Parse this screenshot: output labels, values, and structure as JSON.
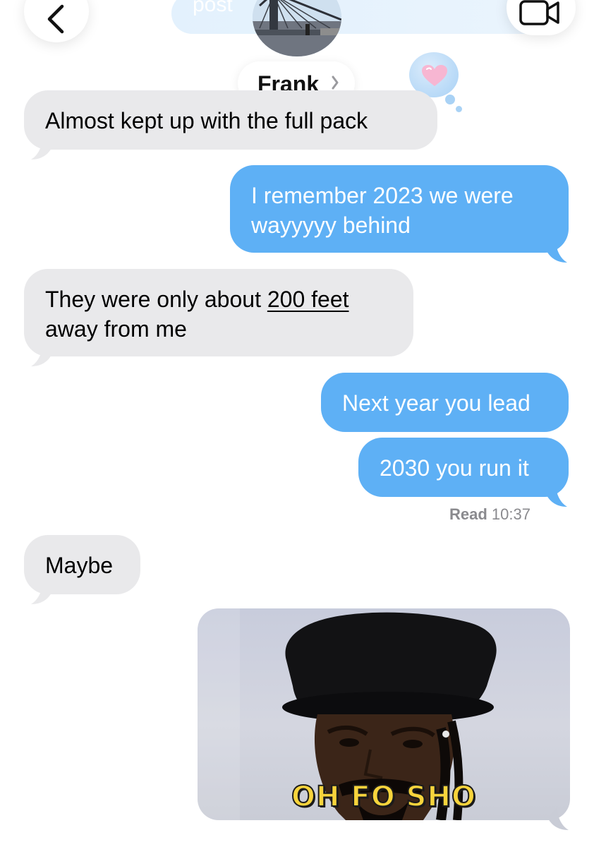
{
  "header": {
    "top_pill_text": "post",
    "contact_name": "Frank",
    "icons": {
      "back": "chevron-left-icon",
      "video": "video-camera-icon",
      "contact_chevron": "chevron-right-icon",
      "heart": "heart-icon"
    }
  },
  "messages": [
    {
      "side": "received",
      "text": "Almost kept up with the full pack"
    },
    {
      "side": "sent",
      "lines": [
        "I remember 2023 we were",
        "wayyyyy behind"
      ]
    },
    {
      "side": "received",
      "lines": [
        "They were only about ",
        "200 feet",
        "away from me"
      ]
    },
    {
      "side": "sent",
      "text": "Next year you lead"
    },
    {
      "side": "sent",
      "text": "2030 you run it"
    },
    {
      "side": "received",
      "text": "Maybe"
    }
  ],
  "read_receipt": {
    "label": "Read",
    "time": "10:37"
  },
  "gif": {
    "caption": "OH FO SHO"
  },
  "colors": {
    "sent_bubble": "#5eb0f5",
    "received_bubble": "#e9e9eb",
    "caption": "#f7d43c"
  }
}
